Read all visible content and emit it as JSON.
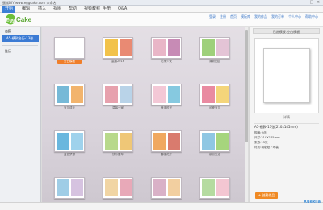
{
  "window": {
    "title": "蛋糕DIY www.eggcake.com  未命名"
  },
  "menu": [
    {
      "label": "开始",
      "active": true
    },
    {
      "label": "编辑"
    },
    {
      "label": "插入"
    },
    {
      "label": "视图"
    },
    {
      "label": "帮助"
    },
    {
      "label": "视频教程"
    },
    {
      "label": "手册"
    },
    {
      "label": "Q&A"
    }
  ],
  "logo": {
    "text1": "Egg",
    "text2": "Cake"
  },
  "toplinks": [
    "登录",
    "注册",
    "首页",
    "模板库",
    "我的作品",
    "我的订单",
    "个人中心",
    "帮助中心"
  ],
  "sidebar": {
    "section1": "台历",
    "selected_item": "A5-横款台历-13张",
    "section2": "挂历"
  },
  "templates": [
    {
      "label": "空白模板",
      "selected": true,
      "a": "#ffffff",
      "b": "#ffffff"
    },
    {
      "label": "童趣2016",
      "a": "#f2c24a",
      "b": "#e98a73"
    },
    {
      "label": "花季少女",
      "a": "#e9b6c7",
      "b": "#c78bb5"
    },
    {
      "label": "清新田园",
      "a": "#9fd07b",
      "b": "#e4c4d6"
    },
    {
      "label": "宝贝成长",
      "a": "#76b9d7",
      "b": "#f2b46d"
    },
    {
      "label": "温馨一家",
      "a": "#e7a1ad",
      "b": "#b9d3e8"
    },
    {
      "label": "浪漫时光",
      "a": "#f3c8d6",
      "b": "#86c9e0"
    },
    {
      "label": "可爱宝贝",
      "a": "#e98aa1",
      "b": "#f4d57a"
    },
    {
      "label": "蓝色梦想",
      "a": "#6ab7de",
      "b": "#9fd2ec"
    },
    {
      "label": "快乐童年",
      "a": "#b8d98b",
      "b": "#efc777"
    },
    {
      "label": "春暖花开",
      "a": "#f0a860",
      "b": "#d97b6e"
    },
    {
      "label": "缤纷生活",
      "a": "#8fc7e3",
      "b": "#a6d57d"
    },
    {
      "label": "",
      "a": "#9fcde6",
      "b": "#d6c3e0"
    },
    {
      "label": "",
      "a": "#f1d5a4",
      "b": "#e8a9b8"
    },
    {
      "label": "",
      "a": "#d9b1c7",
      "b": "#f2cfa0"
    },
    {
      "label": "",
      "a": "#b5dba0",
      "b": "#f3c6d2"
    }
  ],
  "preview": {
    "title": "已选模板:空白模板",
    "name": "详情",
    "spec": "A5-横款-13张(210x145mm)",
    "lines": [
      "规格:台历",
      "尺寸:210X145mm",
      "张数:13张",
      "材质:铜版纸 / 环装"
    ]
  },
  "create_button": "创建作品",
  "watermark": "Xuexila"
}
